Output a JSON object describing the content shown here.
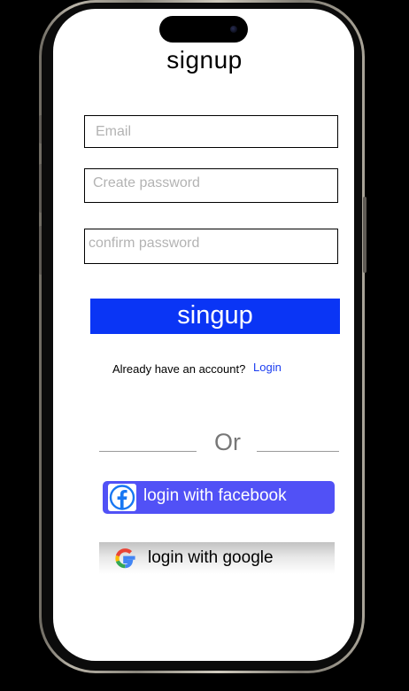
{
  "screen": {
    "title": "signup"
  },
  "form": {
    "email_placeholder": "Email",
    "password_placeholder": "Create password",
    "confirm_placeholder": "confirm password",
    "submit_label": "singup"
  },
  "account": {
    "prompt": "Already have an account?",
    "login_link": "Login"
  },
  "divider": {
    "text": "Or"
  },
  "social": {
    "facebook_label": "login with facebook",
    "facebook_icon": "facebook-icon",
    "google_label": "login with google",
    "google_icon": "google-icon"
  },
  "colors": {
    "primary_button": "#0a35f5",
    "facebook_button": "#5151f6",
    "login_link": "#1a3cf0"
  }
}
